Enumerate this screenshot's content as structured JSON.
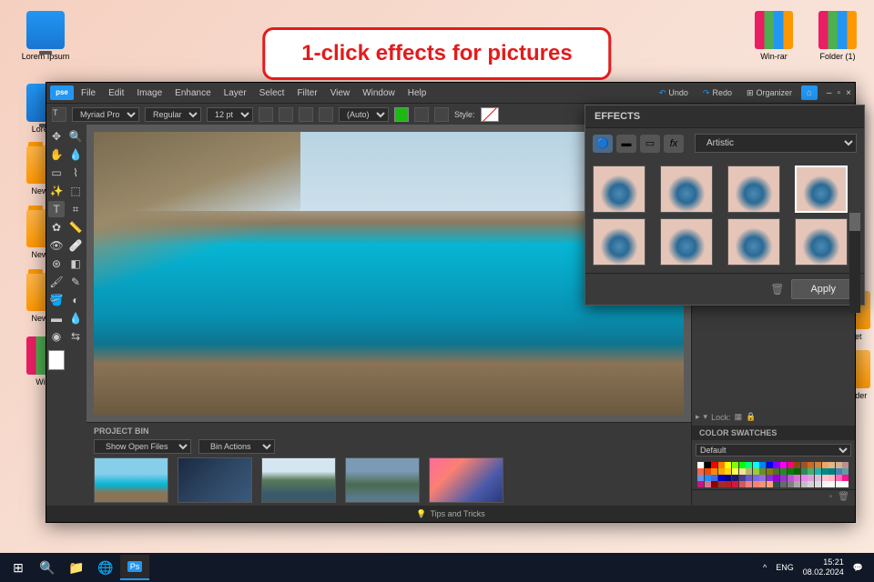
{
  "callout": "1-click effects for pictures",
  "desktop": {
    "icons": [
      {
        "label": "Lorem Ipsum",
        "type": "pc"
      },
      {
        "label": "Lorem I",
        "type": "pc"
      },
      {
        "label": "New Fo",
        "type": "folder"
      },
      {
        "label": "New Fo",
        "type": "folder"
      },
      {
        "label": "New Fo",
        "type": "folder"
      },
      {
        "label": "Win-r",
        "type": "rar"
      },
      {
        "label": "Win-rar",
        "type": "rar"
      },
      {
        "label": "Folder (1)",
        "type": "rar"
      },
      {
        "label": "ternet",
        "type": "folder"
      },
      {
        "label": "w Folder",
        "type": "folder"
      }
    ]
  },
  "app": {
    "logo": "pse",
    "menu": [
      "File",
      "Edit",
      "Image",
      "Enhance",
      "Layer",
      "Select",
      "Filter",
      "View",
      "Window",
      "Help"
    ],
    "undo": "Undo",
    "redo": "Redo",
    "organizer": "Organizer",
    "options": {
      "font": "Myriad Pro",
      "weight": "Regular",
      "size": "12 pt",
      "auto": "(Auto)",
      "style_label": "Style:"
    },
    "project_bin": {
      "title": "PROJECT BIN",
      "show": "Show Open Files",
      "actions": "Bin Actions"
    },
    "panels": {
      "lock_label": "Lock:",
      "swatches_title": "COLOR SWATCHES",
      "swatches_set": "Default"
    },
    "tips": "Tips and Tricks"
  },
  "effects": {
    "title": "EFFECTS",
    "category": "Artistic",
    "apply": "Apply"
  },
  "taskbar": {
    "lang": "ENG",
    "time": "15:21",
    "date": "08.02.2024"
  },
  "colors": {
    "swatches": [
      "#ffffff",
      "#000000",
      "#ff0000",
      "#ff7f00",
      "#ffff00",
      "#7fff00",
      "#00ff00",
      "#00ff7f",
      "#00ffff",
      "#007fff",
      "#0000ff",
      "#7f00ff",
      "#ff00ff",
      "#ff007f",
      "#8b4513",
      "#a0522d",
      "#d2691e",
      "#cd853f",
      "#f4a460",
      "#deb887",
      "#d2b48c",
      "#bc8f8f",
      "#ff6347",
      "#ff4500",
      "#ff8c00",
      "#ffa500",
      "#ffd700",
      "#ffff54",
      "#f0e68c",
      "#bdb76b",
      "#9acd32",
      "#6b8e23",
      "#808000",
      "#556b2f",
      "#228b22",
      "#008000",
      "#006400",
      "#2e8b57",
      "#3cb371",
      "#20b2aa",
      "#008b8b",
      "#008080",
      "#4682b4",
      "#5f9ea0",
      "#6495ed",
      "#1e90ff",
      "#4169e1",
      "#0000cd",
      "#00008b",
      "#191970",
      "#483d8b",
      "#6a5acd",
      "#7b68ee",
      "#9370db",
      "#8a2be2",
      "#9400d3",
      "#9932cc",
      "#ba55d3",
      "#da70d6",
      "#ee82ee",
      "#dda0dd",
      "#d8bfd8",
      "#ffc0cb",
      "#ffb6c1",
      "#ff69b4",
      "#ff1493",
      "#c71585",
      "#db7093",
      "#8b0000",
      "#a52a2a",
      "#b22222",
      "#dc143c",
      "#cd5c5c",
      "#f08080",
      "#fa8072",
      "#e9967a",
      "#ffa07a",
      "#2f4f4f",
      "#696969",
      "#808080",
      "#a9a9a9",
      "#c0c0c0",
      "#d3d3d3",
      "#dcdcdc",
      "#f5f5f5",
      "#fffafa",
      "#f0fff0",
      "#f5fffa"
    ]
  }
}
